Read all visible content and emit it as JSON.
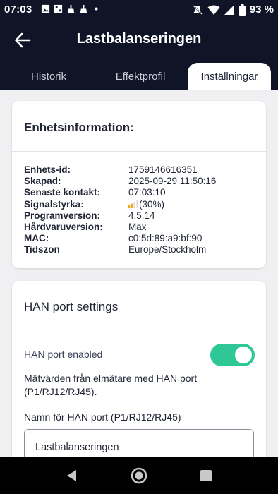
{
  "statusbar": {
    "time": "07:03",
    "battery_text": "93 %",
    "icons": [
      "image-icon",
      "media-icon",
      "cleaning-icon",
      "cleaning-icon",
      "dot-icon",
      "mute-icon",
      "wifi-icon",
      "signal-icon",
      "battery-icon"
    ]
  },
  "header": {
    "title": "Lastbalanseringen",
    "back_icon": "arrow-left-icon"
  },
  "tabs": [
    {
      "label": "Historik",
      "active": false
    },
    {
      "label": "Effektprofil",
      "active": false
    },
    {
      "label": "Inställningar",
      "active": true
    }
  ],
  "device_info": {
    "title": "Enhetsinformation:",
    "rows": [
      {
        "key": "Enhets-id:",
        "value": "1759146616351"
      },
      {
        "key": "Skapad:",
        "value": "2025-09-29 11:50:16"
      },
      {
        "key": "Senaste kontakt:",
        "value": "07:03:10"
      },
      {
        "key": "Signalstyrka:",
        "value": "(30%)"
      },
      {
        "key": "Programversion:",
        "value": "4.5.14"
      },
      {
        "key": "Hårdvaruversion:",
        "value": "Max"
      },
      {
        "key": "MAC:",
        "value": "c0:5d:89:a9:bf:90"
      },
      {
        "key": "Tidszon",
        "value": "Europe/Stockholm"
      }
    ],
    "signal_strength_fraction": 0.3
  },
  "han_port": {
    "title": "HAN port settings",
    "toggle_label": "HAN port enabled",
    "enabled": true,
    "description": "Mätvärden från elmätare med HAN port (P1/RJ12/RJ45).",
    "name_label": "Namn för HAN port (P1/RJ12/RJ45)",
    "name_value": "Lastbalanseringen"
  },
  "colors": {
    "header_bg": "#0f1527",
    "toggle_on": "#2fc796",
    "signal_active": "#f0a81c",
    "page_bg": "#f0f0f2"
  },
  "navbar": {
    "icons": [
      "back-triangle-icon",
      "home-circle-icon",
      "recents-square-icon"
    ]
  }
}
